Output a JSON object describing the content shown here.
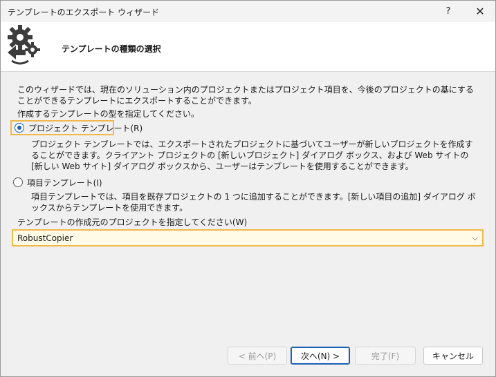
{
  "window": {
    "title": "テンプレートのエクスポート ウィザード",
    "help_glyph": "?",
    "close_glyph": "✕"
  },
  "header": {
    "title": "テンプレートの種類の選択",
    "icon": "gears-arrow-icon"
  },
  "content": {
    "description": "このウィザードでは、現在のソリューション内のプロジェクトまたはプロジェクト項目を、今後のプロジェクトの基にすることができるテンプレートにエクスポートすることができます。",
    "type_prompt": "作成するテンプレートの型を指定してください。",
    "options": [
      {
        "label": "プロジェクト テンプレート(R)",
        "selected": true,
        "description": "プロジェクト テンプレートでは、エクスポートされたプロジェクトに基づいてユーザーが新しいプロジェクトを作成することができます。クライアント プロジェクトの [新しいプロジェクト] ダイアログ ボックス、および Web サイトの [新しい Web サイト] ダイアログ ボックスから、ユーザーはテンプレートを使用することができます。"
      },
      {
        "label": "項目テンプレート(I)",
        "selected": false,
        "description": "項目テンプレートでは、項目を既存プロジェクトの 1 つに追加することができます。[新しい項目の追加] ダイアログ ボックスからテンプレートを使用できます。"
      }
    ],
    "project_label": "テンプレートの作成元のプロジェクトを指定してください(W)",
    "project_value": "RobustCopier",
    "combo_arrow": "⌵"
  },
  "buttons": {
    "back": "< 前へ(P)",
    "next": "次へ(N) >",
    "finish": "完了(F)",
    "cancel": "キャンセル"
  },
  "colors": {
    "focus": "#f2b84b",
    "accent": "#1a5fb4"
  }
}
